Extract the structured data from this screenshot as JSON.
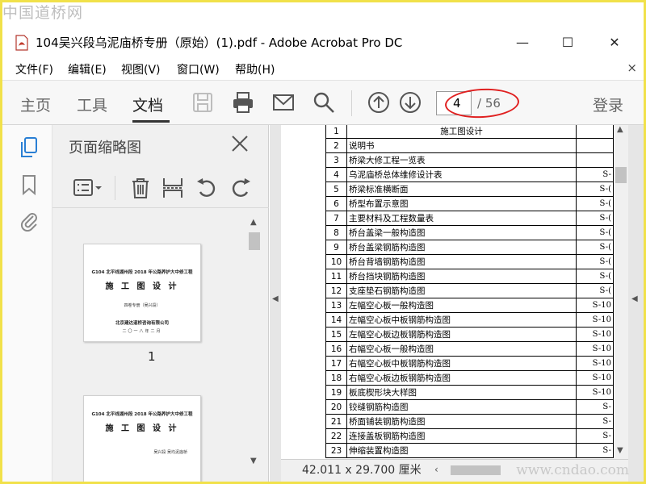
{
  "watermarks": {
    "top": "中国道桥网",
    "bottom": "www.cndao.com"
  },
  "window": {
    "title": "104吴兴段乌泥庙桥专册（原始）(1).pdf - Adobe Acrobat Pro DC",
    "minimize": "—",
    "maximize": "☐",
    "close": "✕"
  },
  "menu": {
    "items": [
      "文件(F)",
      "编辑(E)",
      "视图(V)",
      "窗口(W)",
      "帮助(H)"
    ],
    "close": "×"
  },
  "toolbar": {
    "tabs": [
      "主页",
      "工具",
      "文档"
    ],
    "active_tab": "文档",
    "page_current": "4",
    "page_total": "/ 56",
    "login": "登录"
  },
  "thumbnails": {
    "title": "页面缩略图",
    "pages": [
      {
        "number": "1",
        "line1": "G104 北平线湖州段 2018 年公路养护大中修工程",
        "line2": "施 工 图 设 计",
        "line3": "四卷专册（吴兴段）",
        "line4": "北京建达道桥咨询有限公司",
        "line5": "二〇一八年二月"
      },
      {
        "line1": "G104 北平线湖州段 2018 年公路养护大中修工程",
        "line2": "施 工 图 设 计",
        "line3": "吴兴段  吴均泥庙桥",
        "line4": "",
        "line5": ""
      }
    ]
  },
  "document": {
    "rows": [
      {
        "n": "1",
        "title": "施工图设计",
        "code": "",
        "header": true
      },
      {
        "n": "2",
        "title": "说明书",
        "code": ""
      },
      {
        "n": "3",
        "title": "桥梁大修工程一览表",
        "code": ""
      },
      {
        "n": "4",
        "title": "乌泥庙桥总体维修设计表",
        "code": "S-"
      },
      {
        "n": "5",
        "title": "桥梁标准横断面",
        "code": "S-("
      },
      {
        "n": "6",
        "title": "桥型布置示意图",
        "code": "S-("
      },
      {
        "n": "7",
        "title": "主要材料及工程数量表",
        "code": "S-("
      },
      {
        "n": "8",
        "title": "桥台盖梁一般构造图",
        "code": "S-("
      },
      {
        "n": "9",
        "title": "桥台盖梁钢筋构造图",
        "code": "S-("
      },
      {
        "n": "10",
        "title": "桥台背墙钢筋构造图",
        "code": "S-("
      },
      {
        "n": "11",
        "title": "桥台挡块钢筋构造图",
        "code": "S-("
      },
      {
        "n": "12",
        "title": "支座垫石钢筋构造图",
        "code": "S-("
      },
      {
        "n": "13",
        "title": "左幅空心板一般构造图",
        "code": "S-10"
      },
      {
        "n": "14",
        "title": "左幅空心板中板钢筋构造图",
        "code": "S-10"
      },
      {
        "n": "15",
        "title": "左幅空心板边板钢筋构造图",
        "code": "S-10"
      },
      {
        "n": "16",
        "title": "右幅空心板一般构造图",
        "code": "S-10"
      },
      {
        "n": "17",
        "title": "右幅空心板中板钢筋构造图",
        "code": "S-10"
      },
      {
        "n": "18",
        "title": "右幅空心板边板钢筋构造图",
        "code": "S-10"
      },
      {
        "n": "19",
        "title": "板底楔形块大样图",
        "code": "S-10"
      },
      {
        "n": "20",
        "title": "铰缝钢筋构造图",
        "code": "S-"
      },
      {
        "n": "21",
        "title": "桥面铺装钢筋构造图",
        "code": "S-"
      },
      {
        "n": "22",
        "title": "连接盖板钢筋构造图",
        "code": "S-"
      },
      {
        "n": "23",
        "title": "伸缩装置构造图",
        "code": "S-"
      }
    ],
    "dimensions": "42.011 x 29.700 厘米"
  },
  "colors": {
    "annotation_oval": "#e02020",
    "frame_border": "#f1e14a"
  }
}
